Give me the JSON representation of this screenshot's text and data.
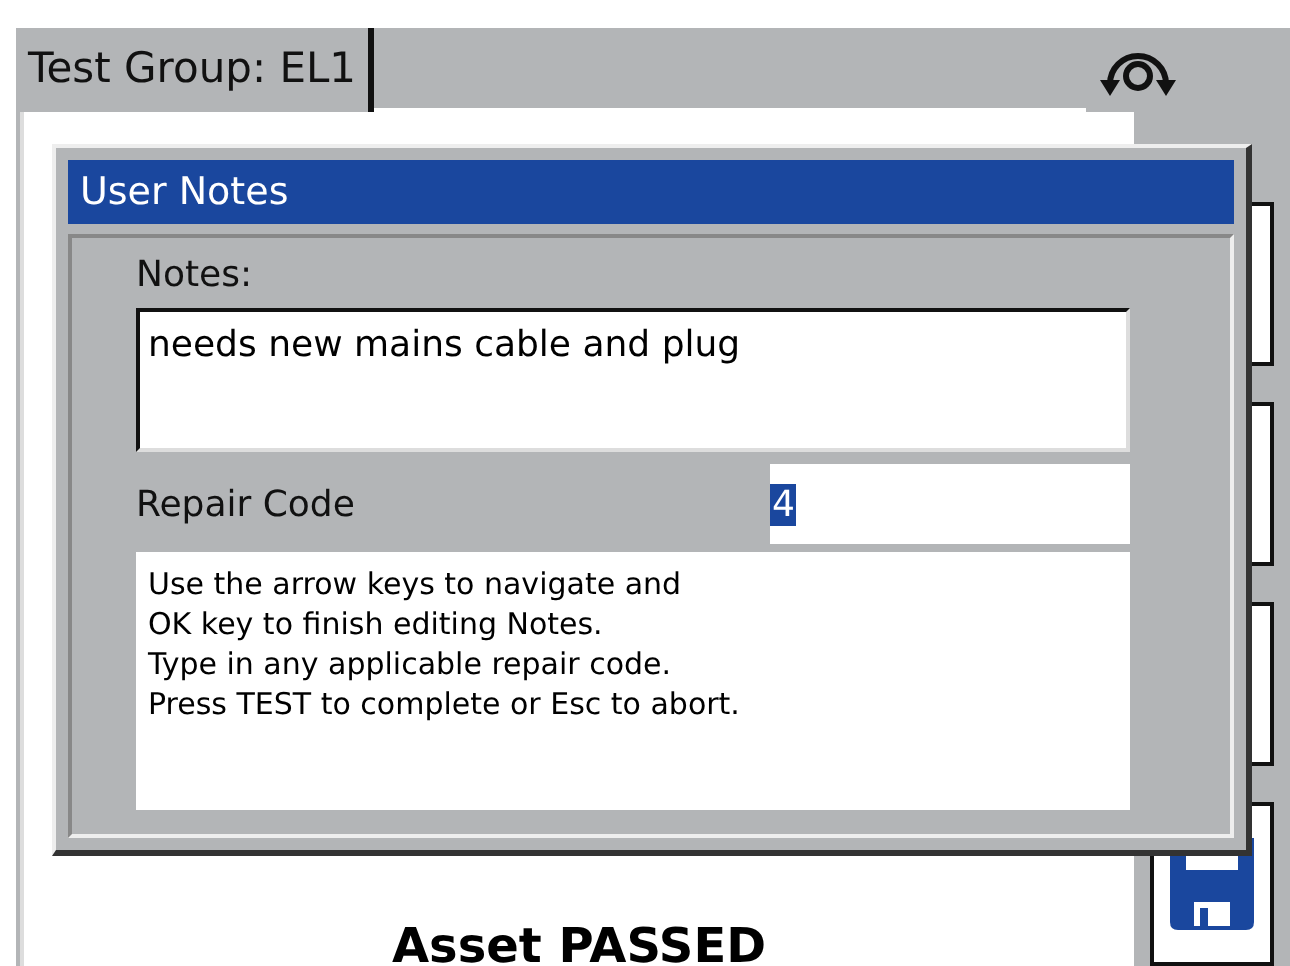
{
  "tab": {
    "label": "Test Group: EL1",
    "selected": true
  },
  "status": "Asset PASSED",
  "side_buttons": [
    {
      "kind": "blank"
    },
    {
      "kind": "blank"
    },
    {
      "kind": "blank"
    },
    {
      "kind": "save"
    }
  ],
  "dialog": {
    "title": "User Notes",
    "notes_label": "Notes:",
    "notes_value": "needs new mains cable and plug",
    "repair_label": "Repair Code",
    "repair_value": "4",
    "help": [
      "Use the arrow keys to navigate and",
      "OK key to finish editing Notes.",
      "Type in any applicable repair code.",
      "Press TEST to complete or Esc to abort."
    ]
  }
}
